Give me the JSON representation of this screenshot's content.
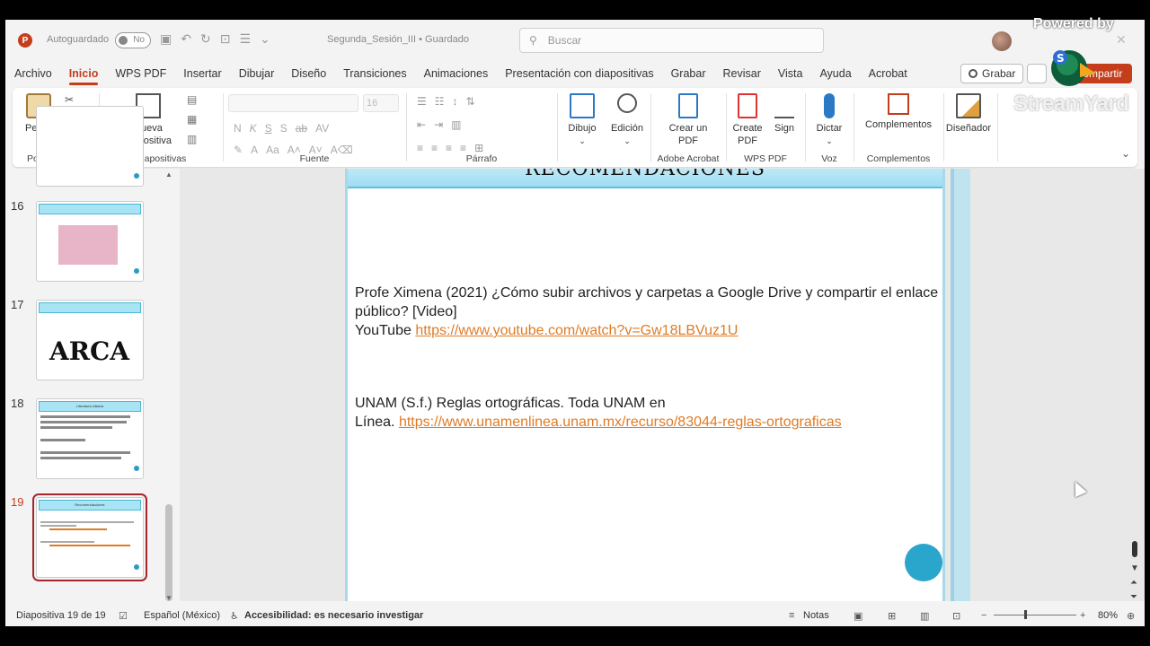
{
  "titlebar": {
    "autosave_label": "Autoguardado",
    "toggle_state": "No",
    "doc_title": "Segunda_Sesión_III • Guardado",
    "search_placeholder": "Buscar"
  },
  "menu": {
    "tabs": [
      "Archivo",
      "Inicio",
      "WPS PDF",
      "Insertar",
      "Dibujar",
      "Diseño",
      "Transiciones",
      "Animaciones",
      "Presentación con diapositivas",
      "Grabar",
      "Revisar",
      "Vista",
      "Ayuda",
      "Acrobat"
    ],
    "active_tab": "Inicio",
    "record_label": "Grabar",
    "share_label": "Compartir"
  },
  "ribbon": {
    "paste_label": "Pegar",
    "clipboard_group": "Portapapeles",
    "new_slide_label": "Nueva diapositiva",
    "slides_group": "Diapositivas",
    "font_group": "Fuente",
    "font_size": "16",
    "paragraph_group": "Párrafo",
    "drawing_label": "Dibujo",
    "editing_label": "Edición",
    "create_pdf_label": "Crear un PDF",
    "acrobat_group": "Adobe Acrobat",
    "create_pdf2_label": "Create PDF",
    "sign_label": "Sign",
    "wps_group": "WPS PDF",
    "dictate_label": "Dictar",
    "voice_group": "Voz",
    "addins_label": "Complementos",
    "addins_group": "Complementos",
    "designer_label": "Diseñador"
  },
  "thumbnails": [
    {
      "num": "16",
      "title": ""
    },
    {
      "num": "17",
      "title": "ARCA"
    },
    {
      "num": "18",
      "title": "Literatura clásica"
    },
    {
      "num": "19",
      "title": "Recomendaciones"
    }
  ],
  "slide": {
    "title": "RECOMENDACIONES",
    "ref1_text": "Profe Ximena (2021) ¿Cómo subir archivos y carpetas a Google Drive y compartir el enlace público? [Video]",
    "ref1_prefix": "YouTube ",
    "ref1_link": "https://www.youtube.com/watch?v=Gw18LBVuz1U",
    "ref2_text": "UNAM (S.f.) Reglas ortográficas. Toda UNAM en",
    "ref2_prefix": "Línea. ",
    "ref2_link": "https://www.unamenlinea.unam.mx/recurso/83044-reglas-ortograficas"
  },
  "status": {
    "slide_counter": "Diapositiva 19 de 19",
    "language": "Español (México)",
    "accessibility": "Accesibilidad: es necesario investigar",
    "notes_label": "Notas",
    "zoom": "80%"
  },
  "watermark": {
    "powered": "Powered by",
    "brand": "StreamYard"
  },
  "colors": {
    "accent": "#c43e1c",
    "link": "#e07b24",
    "slide_header": "#a8e4f4",
    "circle": "#2aa5cc"
  }
}
